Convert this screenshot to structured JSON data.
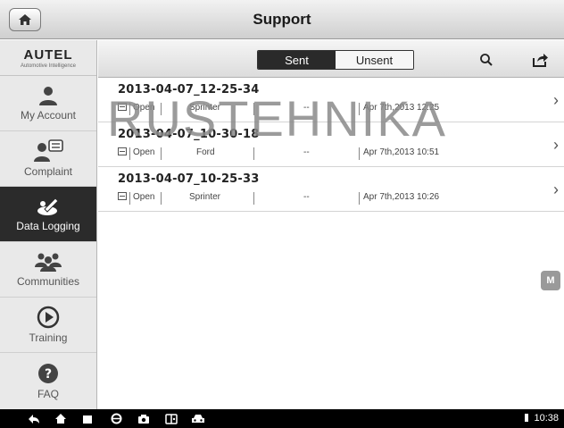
{
  "header": {
    "title": "Support"
  },
  "sidebar": {
    "brand": "AUTEL",
    "tagline": "Automotive Intelligence",
    "items": [
      {
        "label": "My Account",
        "icon": "person-icon",
        "active": false
      },
      {
        "label": "Complaint",
        "icon": "complaint-icon",
        "active": false
      },
      {
        "label": "Data Logging",
        "icon": "data-logging-icon",
        "active": true
      },
      {
        "label": "Communities",
        "icon": "people-icon",
        "active": false
      },
      {
        "label": "Training",
        "icon": "play-icon",
        "active": false
      },
      {
        "label": "FAQ",
        "icon": "question-icon",
        "active": false
      }
    ]
  },
  "toolbar": {
    "sent_label": "Sent",
    "unsent_label": "Unsent",
    "selected": "Sent"
  },
  "logs": [
    {
      "name": "2013-04-07_12-25-34",
      "status": "Open",
      "vehicle": "Sprinter",
      "extra": "--",
      "date": "Apr 7th,2013 12:25"
    },
    {
      "name": "2013-04-07_10-30-18",
      "status": "Open",
      "vehicle": "Ford",
      "extra": "--",
      "date": "Apr 7th,2013 10:51"
    },
    {
      "name": "2013-04-07_10-25-33",
      "status": "Open",
      "vehicle": "Sprinter",
      "extra": "--",
      "date": "Apr 7th,2013 10:26"
    }
  ],
  "watermark": "RUSTEHNIKA",
  "m_badge": "M",
  "status_bar": {
    "time": "10:38"
  }
}
